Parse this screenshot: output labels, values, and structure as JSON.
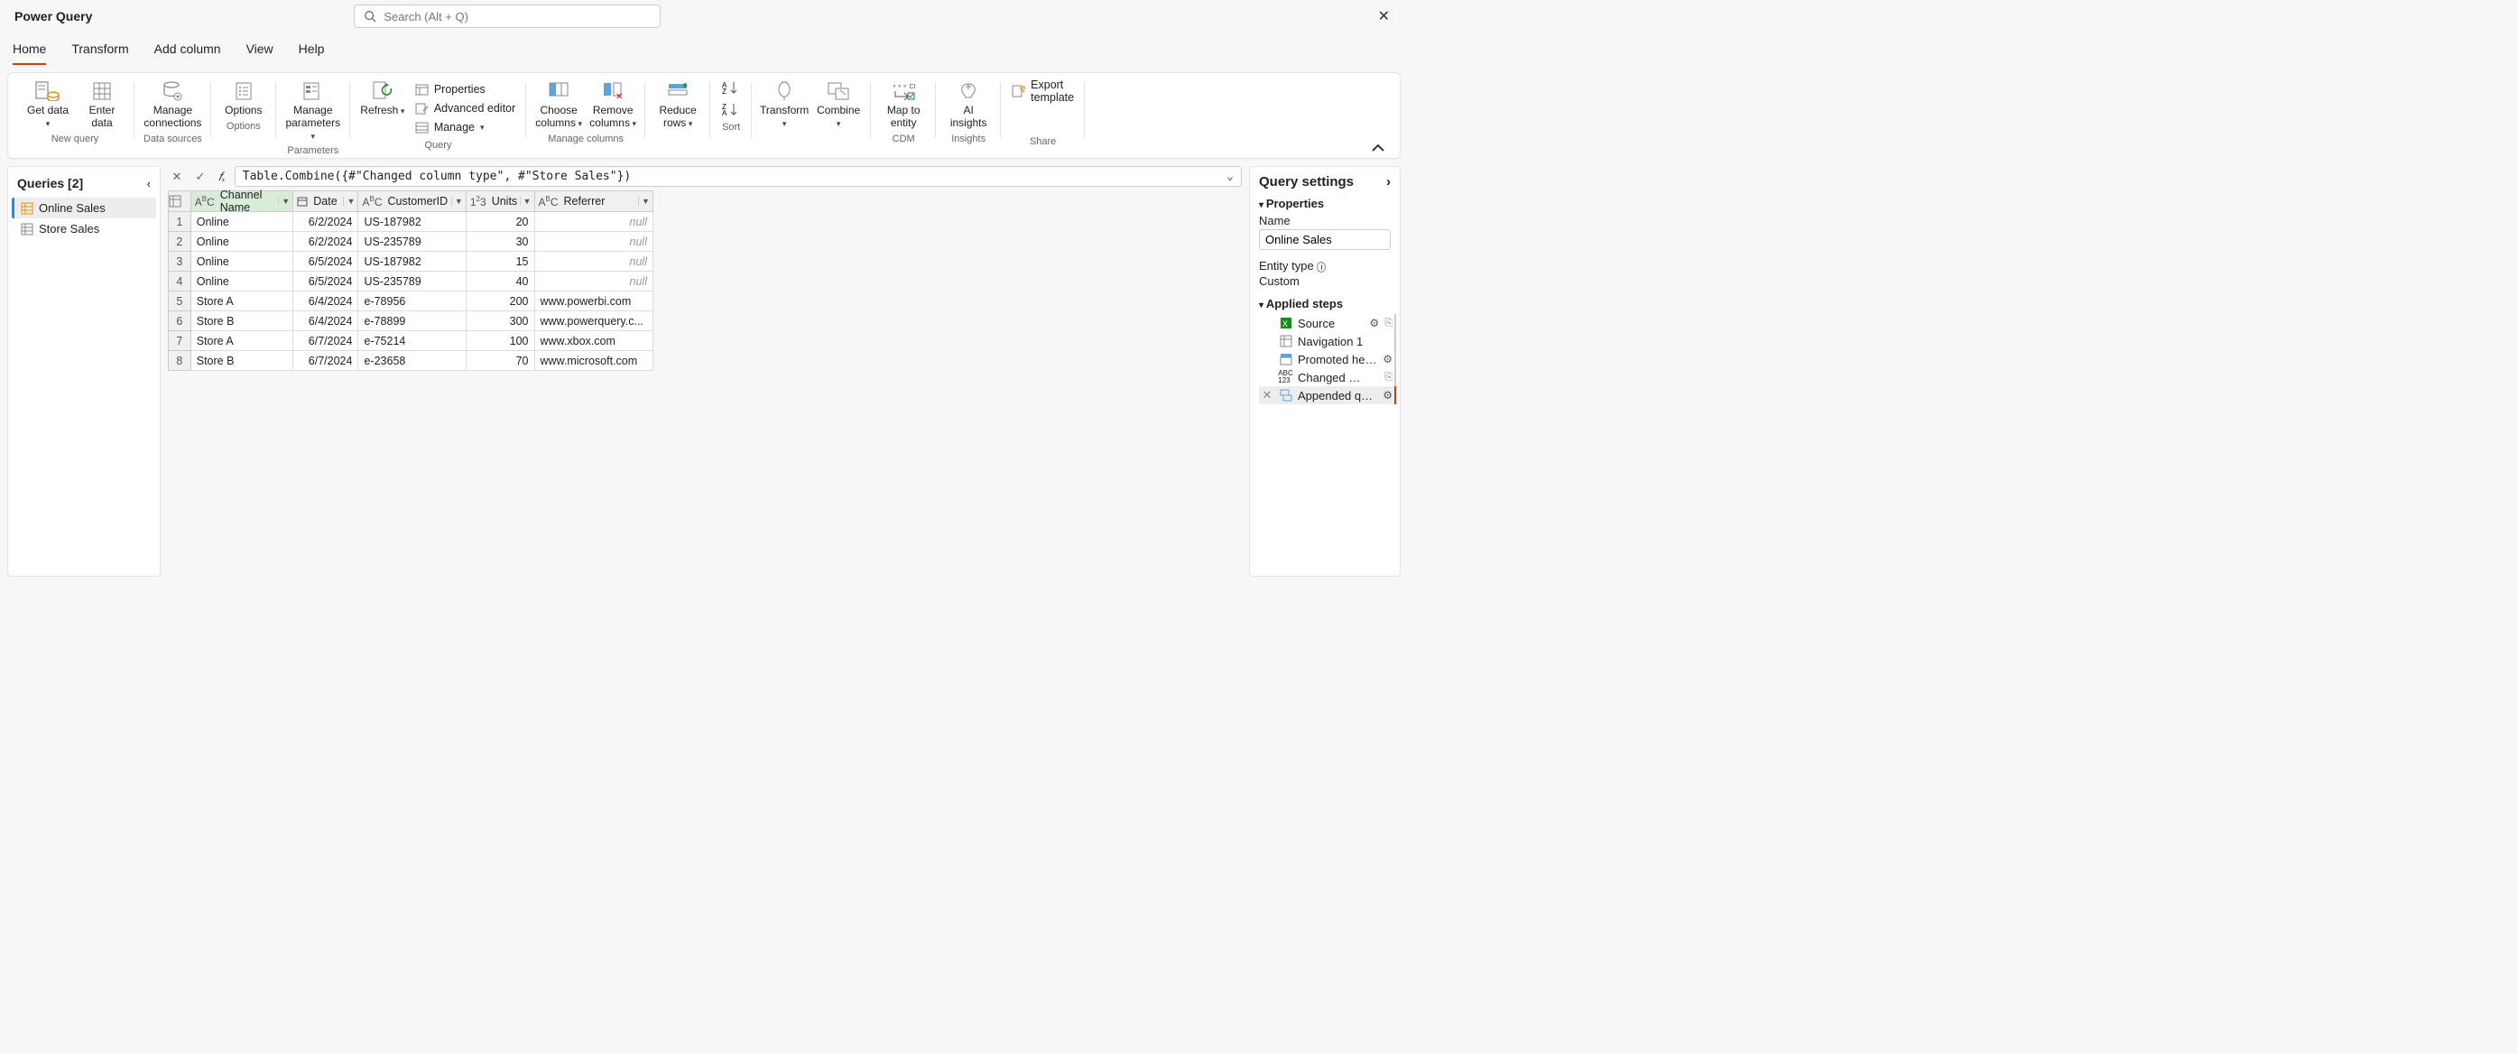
{
  "app_title": "Power Query",
  "search_placeholder": "Search (Alt + Q)",
  "tabs": [
    "Home",
    "Transform",
    "Add column",
    "View",
    "Help"
  ],
  "active_tab": 0,
  "ribbon": {
    "new_query": {
      "get_data": "Get data",
      "enter_data": "Enter data",
      "label": "New query"
    },
    "data_sources": {
      "manage_connections": "Manage connections",
      "label": "Data sources"
    },
    "options": {
      "options": "Options",
      "label": "Options"
    },
    "parameters": {
      "manage_parameters": "Manage parameters",
      "label": "Parameters"
    },
    "query": {
      "refresh": "Refresh",
      "properties": "Properties",
      "advanced": "Advanced editor",
      "manage": "Manage",
      "label": "Query"
    },
    "manage_columns": {
      "choose": "Choose columns",
      "remove": "Remove columns",
      "label": "Manage columns"
    },
    "reduce_rows": {
      "reduce": "Reduce rows",
      "label": ""
    },
    "sort": {
      "label": "Sort"
    },
    "transform": {
      "transform": "Transform",
      "combine": "Combine"
    },
    "cdm": {
      "map": "Map to entity",
      "label": "CDM"
    },
    "insights": {
      "ai": "AI insights",
      "label": "Insights"
    },
    "share": {
      "export": "Export template",
      "label": "Share"
    }
  },
  "queries_title": "Queries [2]",
  "queries": [
    {
      "name": "Online Sales",
      "active": true
    },
    {
      "name": "Store Sales",
      "active": false
    }
  ],
  "formula": "Table.Combine({#\"Changed column type\", #\"Store Sales\"})",
  "columns": [
    {
      "name": "Channel Name",
      "type": "ABC",
      "selected": true
    },
    {
      "name": "Date",
      "type": "date"
    },
    {
      "name": "CustomerID",
      "type": "ABC"
    },
    {
      "name": "Units",
      "type": "123"
    },
    {
      "name": "Referrer",
      "type": "ABC"
    }
  ],
  "rows": [
    {
      "n": 1,
      "c": [
        "Online",
        "6/2/2024",
        "US-187982",
        "20",
        null
      ]
    },
    {
      "n": 2,
      "c": [
        "Online",
        "6/2/2024",
        "US-235789",
        "30",
        null
      ]
    },
    {
      "n": 3,
      "c": [
        "Online",
        "6/5/2024",
        "US-187982",
        "15",
        null
      ]
    },
    {
      "n": 4,
      "c": [
        "Online",
        "6/5/2024",
        "US-235789",
        "40",
        null
      ]
    },
    {
      "n": 5,
      "c": [
        "Store A",
        "6/4/2024",
        "e-78956",
        "200",
        "www.powerbi.com"
      ]
    },
    {
      "n": 6,
      "c": [
        "Store B",
        "6/4/2024",
        "e-78899",
        "300",
        "www.powerquery.c..."
      ]
    },
    {
      "n": 7,
      "c": [
        "Store A",
        "6/7/2024",
        "e-75214",
        "100",
        "www.xbox.com"
      ]
    },
    {
      "n": 8,
      "c": [
        "Store B",
        "6/7/2024",
        "e-23658",
        "70",
        "www.microsoft.com"
      ]
    }
  ],
  "settings": {
    "title": "Query settings",
    "properties": "Properties",
    "name_label": "Name",
    "name_value": "Online Sales",
    "entity_label": "Entity type",
    "entity_value": "Custom",
    "applied_steps": "Applied steps",
    "steps": [
      {
        "name": "Source",
        "icon": "xls",
        "gear": true,
        "extra": true
      },
      {
        "name": "Navigation 1",
        "icon": "nav"
      },
      {
        "name": "Promoted headers",
        "icon": "hdr",
        "gear": true
      },
      {
        "name": "Changed column type",
        "icon": "abc123",
        "extra": true
      },
      {
        "name": "Appended query",
        "icon": "append",
        "gear": true,
        "active": true
      }
    ]
  }
}
